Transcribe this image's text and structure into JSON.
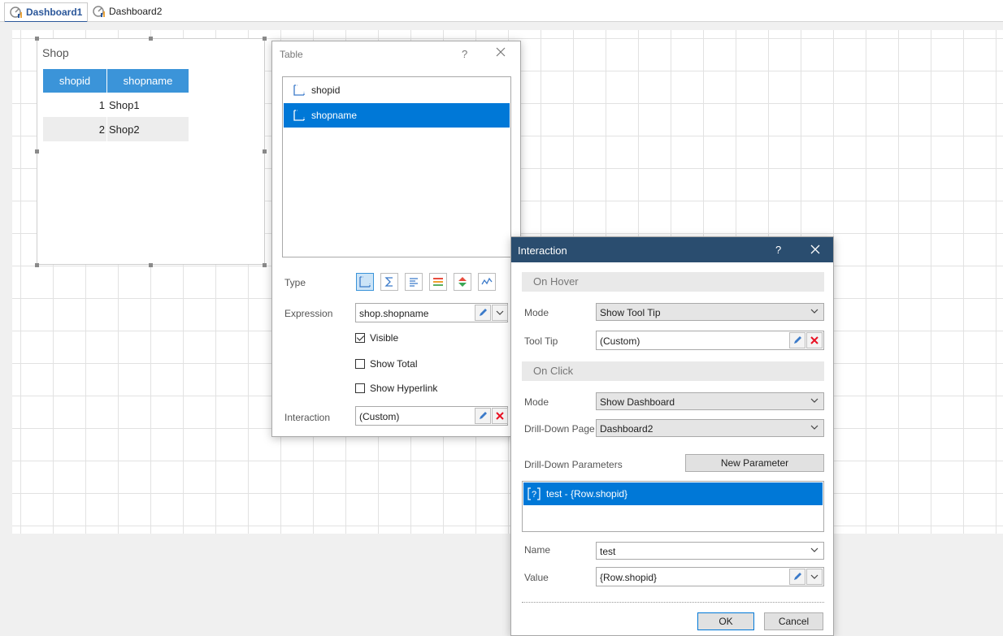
{
  "tabs": [
    {
      "label": "Dashboard1",
      "active": true
    },
    {
      "label": "Dashboard2",
      "active": false
    }
  ],
  "shop_widget": {
    "title": "Shop",
    "columns": [
      "shopid",
      "shopname"
    ],
    "rows": [
      {
        "shopid": "1",
        "shopname": "Shop1"
      },
      {
        "shopid": "2",
        "shopname": "Shop2"
      }
    ]
  },
  "table_dialog": {
    "title": "Table",
    "help": "?",
    "fields": [
      {
        "label": "shopid",
        "selected": false
      },
      {
        "label": "shopname",
        "selected": true
      }
    ],
    "type_label": "Type",
    "expression_label": "Expression",
    "expression_value": "shop.shopname",
    "visible_label": "Visible",
    "visible_checked": true,
    "show_total_label": "Show Total",
    "show_total_checked": false,
    "show_hyperlink_label": "Show Hyperlink",
    "show_hyperlink_checked": false,
    "interaction_label": "Interaction",
    "interaction_value": "(Custom)"
  },
  "interaction_dialog": {
    "title": "Interaction",
    "help": "?",
    "on_hover_header": "On Hover",
    "hover_mode_label": "Mode",
    "hover_mode_value": "Show Tool Tip",
    "tooltip_label": "Tool Tip",
    "tooltip_value": "(Custom)",
    "on_click_header": "On Click",
    "click_mode_label": "Mode",
    "click_mode_value": "Show Dashboard",
    "drilldown_page_label": "Drill-Down Page",
    "drilldown_page_value": "Dashboard2",
    "drilldown_params_label": "Drill-Down Parameters",
    "new_parameter_label": "New Parameter",
    "parameter_item": "test - {Row.shopid}",
    "name_label": "Name",
    "name_value": "test",
    "value_label": "Value",
    "value_value": "{Row.shopid}",
    "ok_label": "OK",
    "cancel_label": "Cancel"
  },
  "colors": {
    "accent": "#0078d7",
    "header_blue": "#3b94d9",
    "title_bar": "#2a4d6f",
    "delete_red": "#e81123"
  }
}
